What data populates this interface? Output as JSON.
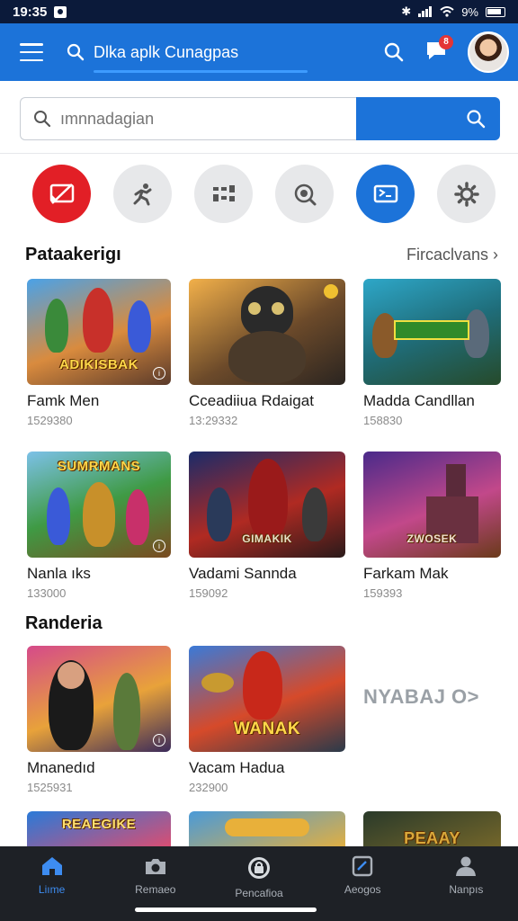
{
  "status_bar": {
    "time": "19:35",
    "battery": "9%"
  },
  "app_bar": {
    "search_label": "Dlka aplk Cunagpas",
    "notification_count": "8"
  },
  "search": {
    "placeholder": "ımnnadagian"
  },
  "categories": [
    {
      "icon": "cast-off-icon",
      "active_color": "#e21f26"
    },
    {
      "icon": "runner-icon"
    },
    {
      "icon": "grid-icon"
    },
    {
      "icon": "zoom-icon"
    },
    {
      "icon": "cast-icon",
      "active_color": "#1c73d9"
    },
    {
      "icon": "settings-icon"
    }
  ],
  "section1": {
    "title": "Pataakerigı",
    "see_all": "Fircaclvans",
    "items": [
      {
        "name": "Famk Men",
        "count": "1529380",
        "art": "ADIKISBAK"
      },
      {
        "name": "Cceadiiua Rdaigat",
        "count": "13:29332",
        "art": ""
      },
      {
        "name": "Madda Candllan",
        "count": "158830",
        "art": ""
      },
      {
        "name": "Nanla ıks",
        "count": "133000",
        "art": "SUMRMANS"
      },
      {
        "name": "Vadami Sannda",
        "count": "159092",
        "art": "GIMAKIK"
      },
      {
        "name": "Farkam Mak",
        "count": "159393",
        "art": "ZWOSEK"
      }
    ]
  },
  "section2": {
    "title": "Randeria",
    "items": [
      {
        "name": "Mnanedıd",
        "count": "1525931",
        "art": ""
      },
      {
        "name": "Vacam Hadua",
        "count": "232900",
        "art": "WANAK"
      }
    ],
    "promo_text": "NYABAJ O>"
  },
  "row3_art": [
    "REAEGIKE",
    "",
    "PEAAY"
  ],
  "bottom_nav": [
    {
      "label": "Liıme",
      "icon": "home-icon",
      "active": true
    },
    {
      "label": "Remaeo",
      "icon": "camera-icon"
    },
    {
      "label": "Pencafioa",
      "icon": "profile-lock-icon"
    },
    {
      "label": "Aeogos",
      "icon": "tablet-icon"
    },
    {
      "label": "Nanpıs",
      "icon": "person-icon"
    }
  ],
  "colors": {
    "accent": "#1c73d9",
    "danger": "#e21f26",
    "nav_bg": "#1e2126"
  }
}
